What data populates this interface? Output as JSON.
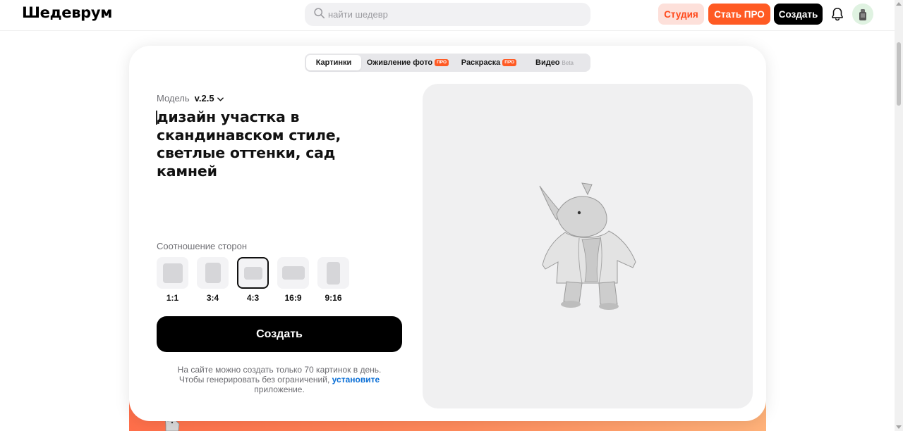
{
  "header": {
    "logo": "Шедеврум",
    "search_placeholder": "найти шедевр",
    "studio_label": "Студия",
    "pro_label": "Стать ПРО",
    "create_label": "Создать"
  },
  "tabs": [
    {
      "label": "Картинки",
      "badge": "",
      "active": true
    },
    {
      "label": "Оживление фото",
      "badge": "ПРО",
      "active": false
    },
    {
      "label": "Раскраска",
      "badge": "ПРО",
      "active": false
    },
    {
      "label": "Видео",
      "badge": "Beta",
      "active": false
    }
  ],
  "model": {
    "label": "Модель",
    "version": "v.2.5"
  },
  "prompt_text": "дизайн участка в скандинавском стиле, светлые оттенки, сад камней",
  "aspect_ratio": {
    "label": "Соотношение сторон",
    "options": [
      "1:1",
      "3:4",
      "4:3",
      "16:9",
      "9:16"
    ],
    "selected": "4:3"
  },
  "create_button": "Создать",
  "note": {
    "text_before": "На сайте можно создать только 70 картинок в день. Чтобы генерировать без ограничений,",
    "link": "установите",
    "text_after": "приложение."
  },
  "colors": {
    "accent": "#ff5a23",
    "studio_bg": "#fde0da",
    "link": "#0b6fd6"
  },
  "icons": {
    "search": "search-icon",
    "bell": "bell-icon",
    "chevron": "chevron-down-icon"
  }
}
